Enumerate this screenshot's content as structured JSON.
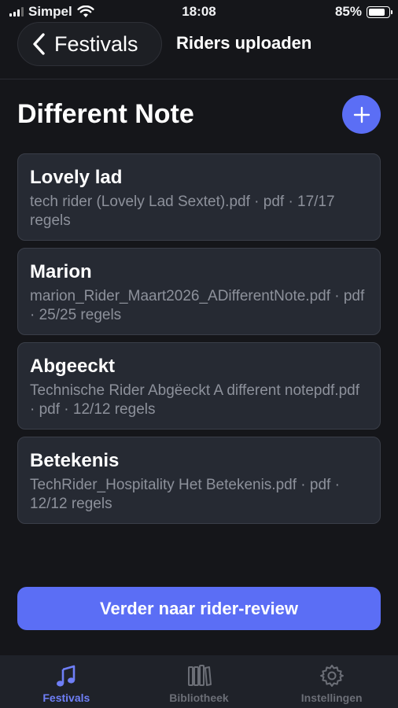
{
  "status_bar": {
    "carrier": "Simpel",
    "time": "18:08",
    "battery_percent": "85%",
    "battery_level": 0.85
  },
  "nav": {
    "back_label": "Festivals",
    "title": "Riders uploaden"
  },
  "page": {
    "title": "Different Note",
    "add_icon": "plus-icon"
  },
  "riders": [
    {
      "name": "Lovely lad",
      "meta": "tech rider (Lovely Lad Sextet).pdf · pdf · 17/17 regels"
    },
    {
      "name": "Marion",
      "meta": "marion_Rider_Maart2026_ADifferentNote.pdf · pdf · 25/25 regels"
    },
    {
      "name": "Abgeeckt",
      "meta": "Technische Rider Abgëeckt A different notepdf.pdf · pdf · 12/12 regels"
    },
    {
      "name": "Betekenis",
      "meta": "TechRider_Hospitality Het Betekenis.pdf · pdf · 12/12 regels"
    }
  ],
  "primary_button": {
    "label": "Verder naar rider-review"
  },
  "tabs": [
    {
      "label": "Festivals",
      "icon": "music-note-icon",
      "active": true
    },
    {
      "label": "Bibliotheek",
      "icon": "books-icon",
      "active": false
    },
    {
      "label": "Instellingen",
      "icon": "gear-icon",
      "active": false
    }
  ],
  "colors": {
    "accent": "#5b6ef5",
    "background": "#15161a",
    "card": "#262a33",
    "tab_active": "#6f7ff7"
  }
}
